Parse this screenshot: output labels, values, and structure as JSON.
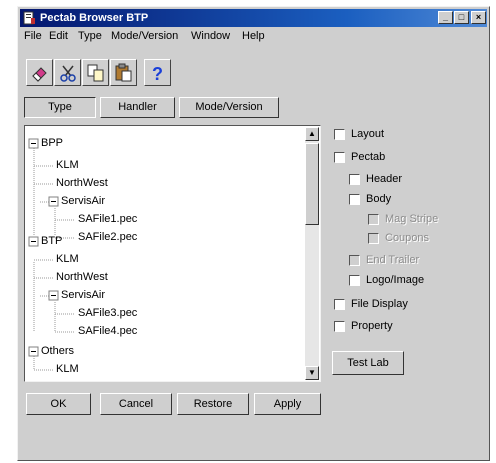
{
  "window": {
    "title": "Pectab Browser BTP",
    "minimize_glyph": "_",
    "maximize_glyph": "□",
    "close_glyph": "×"
  },
  "menu": [
    {
      "label": "File"
    },
    {
      "label": "Edit"
    },
    {
      "label": "Type"
    },
    {
      "label": "Mode/Version"
    },
    {
      "label": "Window"
    },
    {
      "label": "Help"
    }
  ],
  "toolbar": {
    "icons": [
      "eraser-icon",
      "cut-icon",
      "copy-icon",
      "paste-icon",
      "help-icon"
    ],
    "help_glyph": "?"
  },
  "view_tabs": [
    {
      "label": "Type",
      "active": true
    },
    {
      "label": "Handler"
    },
    {
      "label": "Mode/Version"
    }
  ],
  "tree": {
    "nodes": [
      {
        "label": "BPP",
        "level": 0,
        "expander": "minus"
      },
      {
        "label": "KLM",
        "level": 1
      },
      {
        "label": "NorthWest",
        "level": 1
      },
      {
        "label": "ServisAir",
        "level": 1,
        "expander": "minus"
      },
      {
        "label": "SAFile1.pec",
        "level": 2
      },
      {
        "label": "SAFile2.pec",
        "level": 2
      },
      {
        "label": "BTP",
        "level": 0,
        "expander": "minus"
      },
      {
        "label": "KLM",
        "level": 1
      },
      {
        "label": "NorthWest",
        "level": 1
      },
      {
        "label": "ServisAir",
        "level": 1,
        "expander": "minus"
      },
      {
        "label": "SAFile3.pec",
        "level": 2
      },
      {
        "label": "SAFile4.pec",
        "level": 2
      },
      {
        "label": "Others",
        "level": 0,
        "expander": "minus"
      },
      {
        "label": "KLM",
        "level": 1
      }
    ],
    "scroll_up_glyph": "▲",
    "scroll_down_glyph": "▼"
  },
  "options": [
    {
      "label": "Layout",
      "level": 0,
      "enabled": true,
      "checked": false
    },
    {
      "label": "Pectab",
      "level": 0,
      "enabled": true,
      "checked": false
    },
    {
      "label": "Header",
      "level": 1,
      "enabled": true,
      "checked": false
    },
    {
      "label": "Body",
      "level": 1,
      "enabled": true,
      "checked": false
    },
    {
      "label": "Mag Stripe",
      "level": 2,
      "enabled": false,
      "checked": false
    },
    {
      "label": "Coupons",
      "level": 2,
      "enabled": false,
      "checked": false
    },
    {
      "label": "End Trailer",
      "level": 1,
      "enabled": false,
      "checked": false
    },
    {
      "label": "Logo/Image",
      "level": 1,
      "enabled": true,
      "checked": false
    },
    {
      "label": "File Display",
      "level": 0,
      "enabled": true,
      "checked": false
    },
    {
      "label": "Property",
      "level": 0,
      "enabled": true,
      "checked": false
    }
  ],
  "test_lab_button": "Test Lab",
  "buttons": {
    "ok": "OK",
    "cancel": "Cancel",
    "restore": "Restore",
    "apply": "Apply"
  }
}
